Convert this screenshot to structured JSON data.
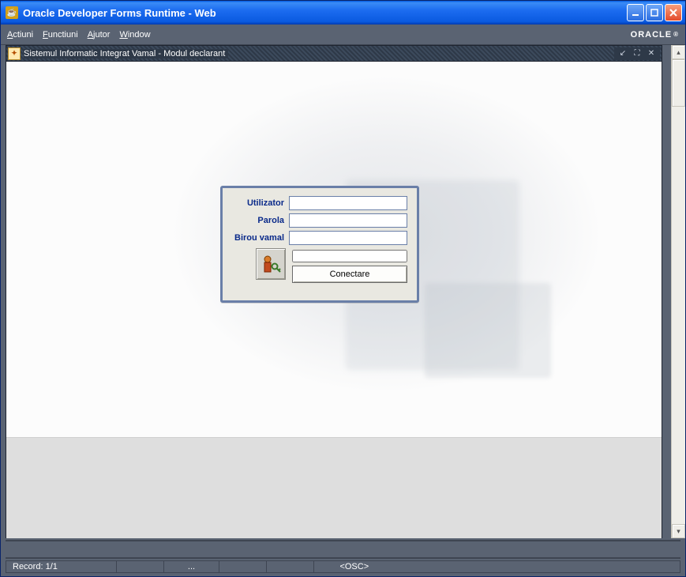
{
  "window": {
    "title": "Oracle Developer Forms Runtime - Web"
  },
  "menubar": {
    "items": [
      {
        "label": "Actiuni",
        "accel": "A"
      },
      {
        "label": "Functiuni",
        "accel": "F"
      },
      {
        "label": "Ajutor",
        "accel": "A"
      },
      {
        "label": "Window",
        "accel": "W"
      }
    ],
    "brand": "ORACLE"
  },
  "mdi": {
    "title": "Sistemul Informatic Integrat Vamal - Modul declarant"
  },
  "login": {
    "user_label": "Utilizator",
    "user_value": "",
    "pass_label": "Parola",
    "pass_value": "",
    "office_label": "Birou vamal",
    "office_value": "",
    "readonly_value": "",
    "connect_label": "Conectare"
  },
  "status": {
    "record": "Record: 1/1",
    "dots": "...",
    "osc": "<OSC>"
  }
}
